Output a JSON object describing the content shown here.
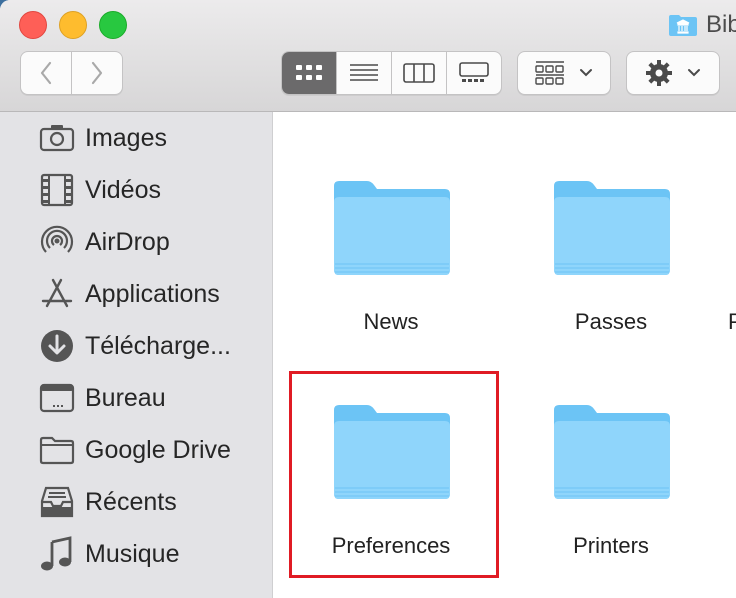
{
  "window": {
    "title": "Bibliothèque",
    "title_icon": "library-folder-icon"
  },
  "toolbar": {
    "back_icon": "chevron-left-icon",
    "forward_icon": "chevron-right-icon",
    "view_modes": [
      {
        "icon": "icon-view-icon",
        "active": true
      },
      {
        "icon": "list-view-icon",
        "active": false
      },
      {
        "icon": "column-view-icon",
        "active": false
      },
      {
        "icon": "gallery-view-icon",
        "active": false
      }
    ],
    "group_icon": "group-grid-icon",
    "action_icon": "gear-icon"
  },
  "sidebar": {
    "items": [
      {
        "label": "Images",
        "icon": "camera-icon"
      },
      {
        "label": "Vidéos",
        "icon": "film-icon"
      },
      {
        "label": "AirDrop",
        "icon": "airdrop-icon"
      },
      {
        "label": "Applications",
        "icon": "applications-icon"
      },
      {
        "label": "Télécharge...",
        "icon": "download-icon"
      },
      {
        "label": "Bureau",
        "icon": "desktop-icon"
      },
      {
        "label": "Google Drive",
        "icon": "folder-icon"
      },
      {
        "label": "Récents",
        "icon": "recents-icon"
      },
      {
        "label": "Musique",
        "icon": "music-note-icon"
      }
    ]
  },
  "content": {
    "folders": [
      {
        "name": "News"
      },
      {
        "name": "Passes"
      },
      {
        "name": "Preferences"
      },
      {
        "name": "Printers"
      }
    ],
    "partial_label": "P"
  },
  "colors": {
    "folder_blue": "#6cc4f5",
    "highlight": "#e01b24",
    "active_segment": "#6b6a6b"
  }
}
